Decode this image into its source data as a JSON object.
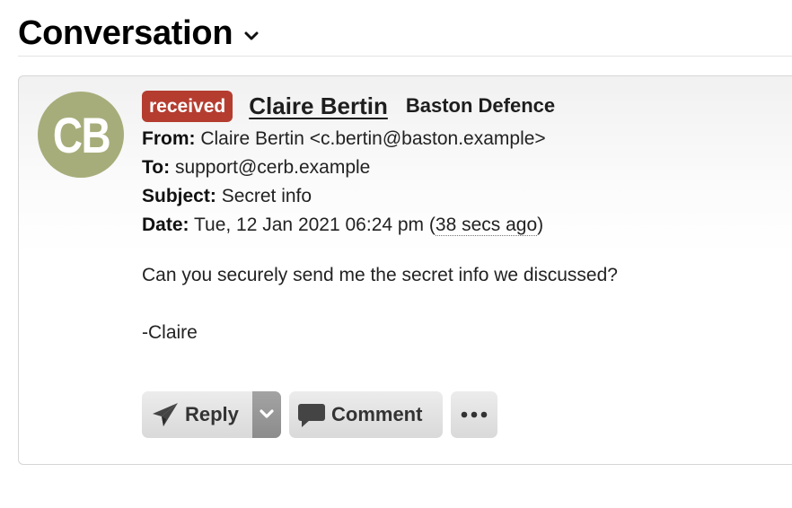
{
  "page": {
    "title": "Conversation"
  },
  "message": {
    "avatar_initials": "CB",
    "avatar_color": "#a7ad7a",
    "status_badge": "received",
    "status_badge_color": "#b43d30",
    "sender_name": "Claire Bertin",
    "sender_org": "Baston Defence",
    "from_label": "From:",
    "from_value": "Claire Bertin <c.bertin@baston.example>",
    "to_label": "To:",
    "to_value": "support@cerb.example",
    "subject_label": "Subject:",
    "subject_value": "Secret info",
    "date_label": "Date:",
    "date_value": "Tue, 12 Jan 2021 06:24 pm",
    "date_relative": "38 secs ago",
    "body_lines": [
      "Can you securely send me the secret info we discussed?",
      "-Claire"
    ]
  },
  "actions": {
    "reply_label": "Reply",
    "comment_label": "Comment",
    "icons": {
      "reply": "paper-plane-icon",
      "reply_dropdown": "chevron-down-icon",
      "comment": "speech-bubble-icon",
      "more": "ellipsis-icon"
    }
  }
}
